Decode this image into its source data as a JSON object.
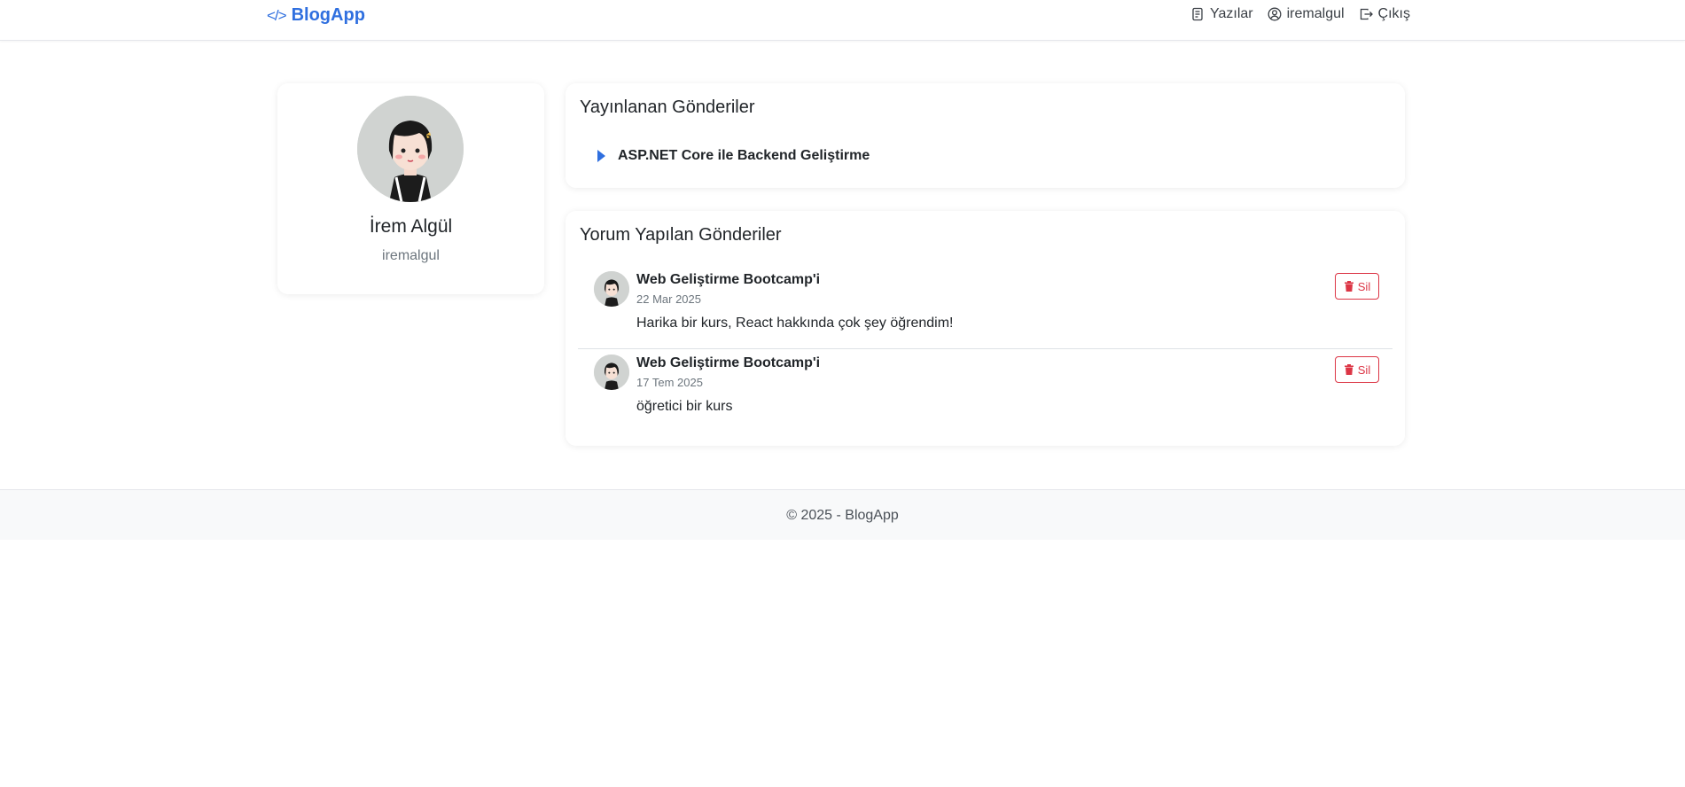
{
  "navbar": {
    "brand": "BlogApp",
    "brand_icon": "code-icon",
    "links": [
      {
        "label": "Yazılar",
        "icon": "document-icon"
      },
      {
        "label": "iremalgul",
        "icon": "user-circle-icon"
      },
      {
        "label": "Çıkış",
        "icon": "logout-icon"
      }
    ]
  },
  "profile": {
    "name": "İrem Algül",
    "username": "iremalgul"
  },
  "published_posts": {
    "title": "Yayınlanan Gönderiler",
    "items": [
      "ASP.NET Core ile Backend Geliştirme"
    ]
  },
  "commented_posts": {
    "title": "Yorum Yapılan Gönderiler",
    "items": [
      {
        "post_title": "Web Geliştirme Bootcamp'i",
        "date": "22 Mar 2025",
        "text": "Harika bir kurs, React hakkında çok şey öğrendim!",
        "delete_label": "Sil"
      },
      {
        "post_title": "Web Geliştirme Bootcamp'i",
        "date": "17 Tem 2025",
        "text": "öğretici bir kurs",
        "delete_label": "Sil"
      }
    ]
  },
  "footer": {
    "text": "© 2025 - BlogApp"
  },
  "colors": {
    "brand": "#2f6fdf",
    "danger": "#dc3545"
  }
}
